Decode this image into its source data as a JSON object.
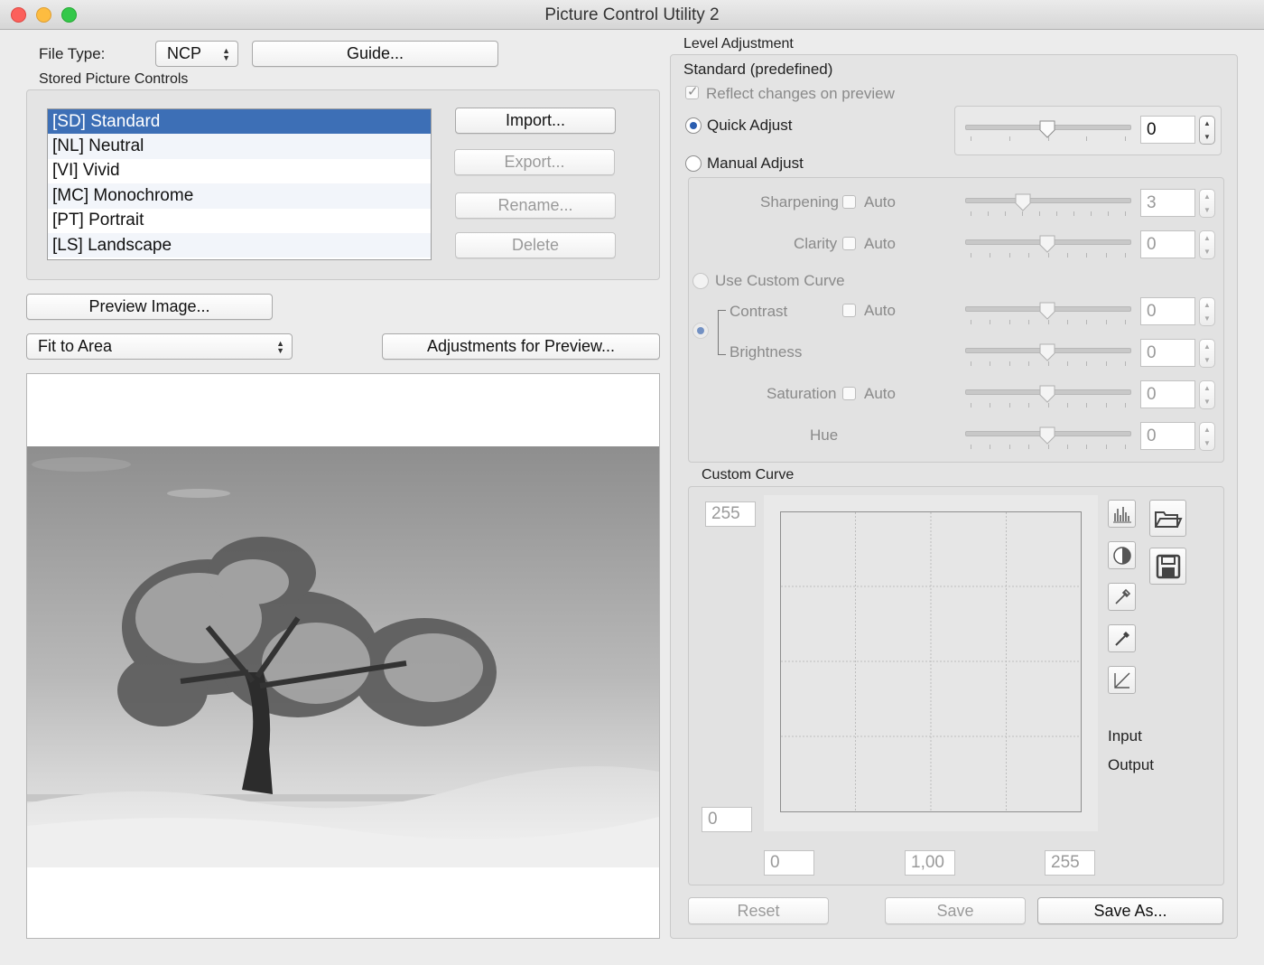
{
  "window": {
    "title": "Picture Control Utility 2"
  },
  "file_type": {
    "label": "File Type:",
    "value": "NCP",
    "guide_button": "Guide..."
  },
  "stored": {
    "label": "Stored Picture Controls",
    "items": [
      "[SD] Standard",
      "[NL] Neutral",
      "[VI] Vivid",
      "[MC] Monochrome",
      "[PT] Portrait",
      "[LS] Landscape"
    ],
    "selected_index": 0,
    "buttons": {
      "import": "Import...",
      "export": "Export...",
      "rename": "Rename...",
      "delete": "Delete"
    }
  },
  "preview": {
    "button": "Preview Image...",
    "fit": "Fit to Area",
    "adjust_button": "Adjustments for Preview..."
  },
  "level": {
    "label": "Level Adjustment",
    "title": "Standard (predefined)",
    "reflect": "Reflect changes on preview",
    "quick_adjust": "Quick Adjust",
    "quick_value": "0",
    "manual_adjust": "Manual Adjust",
    "auto": "Auto",
    "use_custom_curve": "Use Custom Curve",
    "params": {
      "sharpening": {
        "label": "Sharpening",
        "value": "3"
      },
      "clarity": {
        "label": "Clarity",
        "value": "0"
      },
      "contrast": {
        "label": "Contrast",
        "value": "0"
      },
      "brightness": {
        "label": "Brightness",
        "value": "0"
      },
      "saturation": {
        "label": "Saturation",
        "value": "0"
      },
      "hue": {
        "label": "Hue",
        "value": "0"
      }
    }
  },
  "curve": {
    "label": "Custom Curve",
    "out_max": "255",
    "out_min": "0",
    "in_min": "0",
    "gamma": "1,00",
    "in_max": "255",
    "input_label": "Input",
    "output_label": "Output"
  },
  "footer": {
    "reset": "Reset",
    "save": "Save",
    "save_as": "Save As..."
  }
}
